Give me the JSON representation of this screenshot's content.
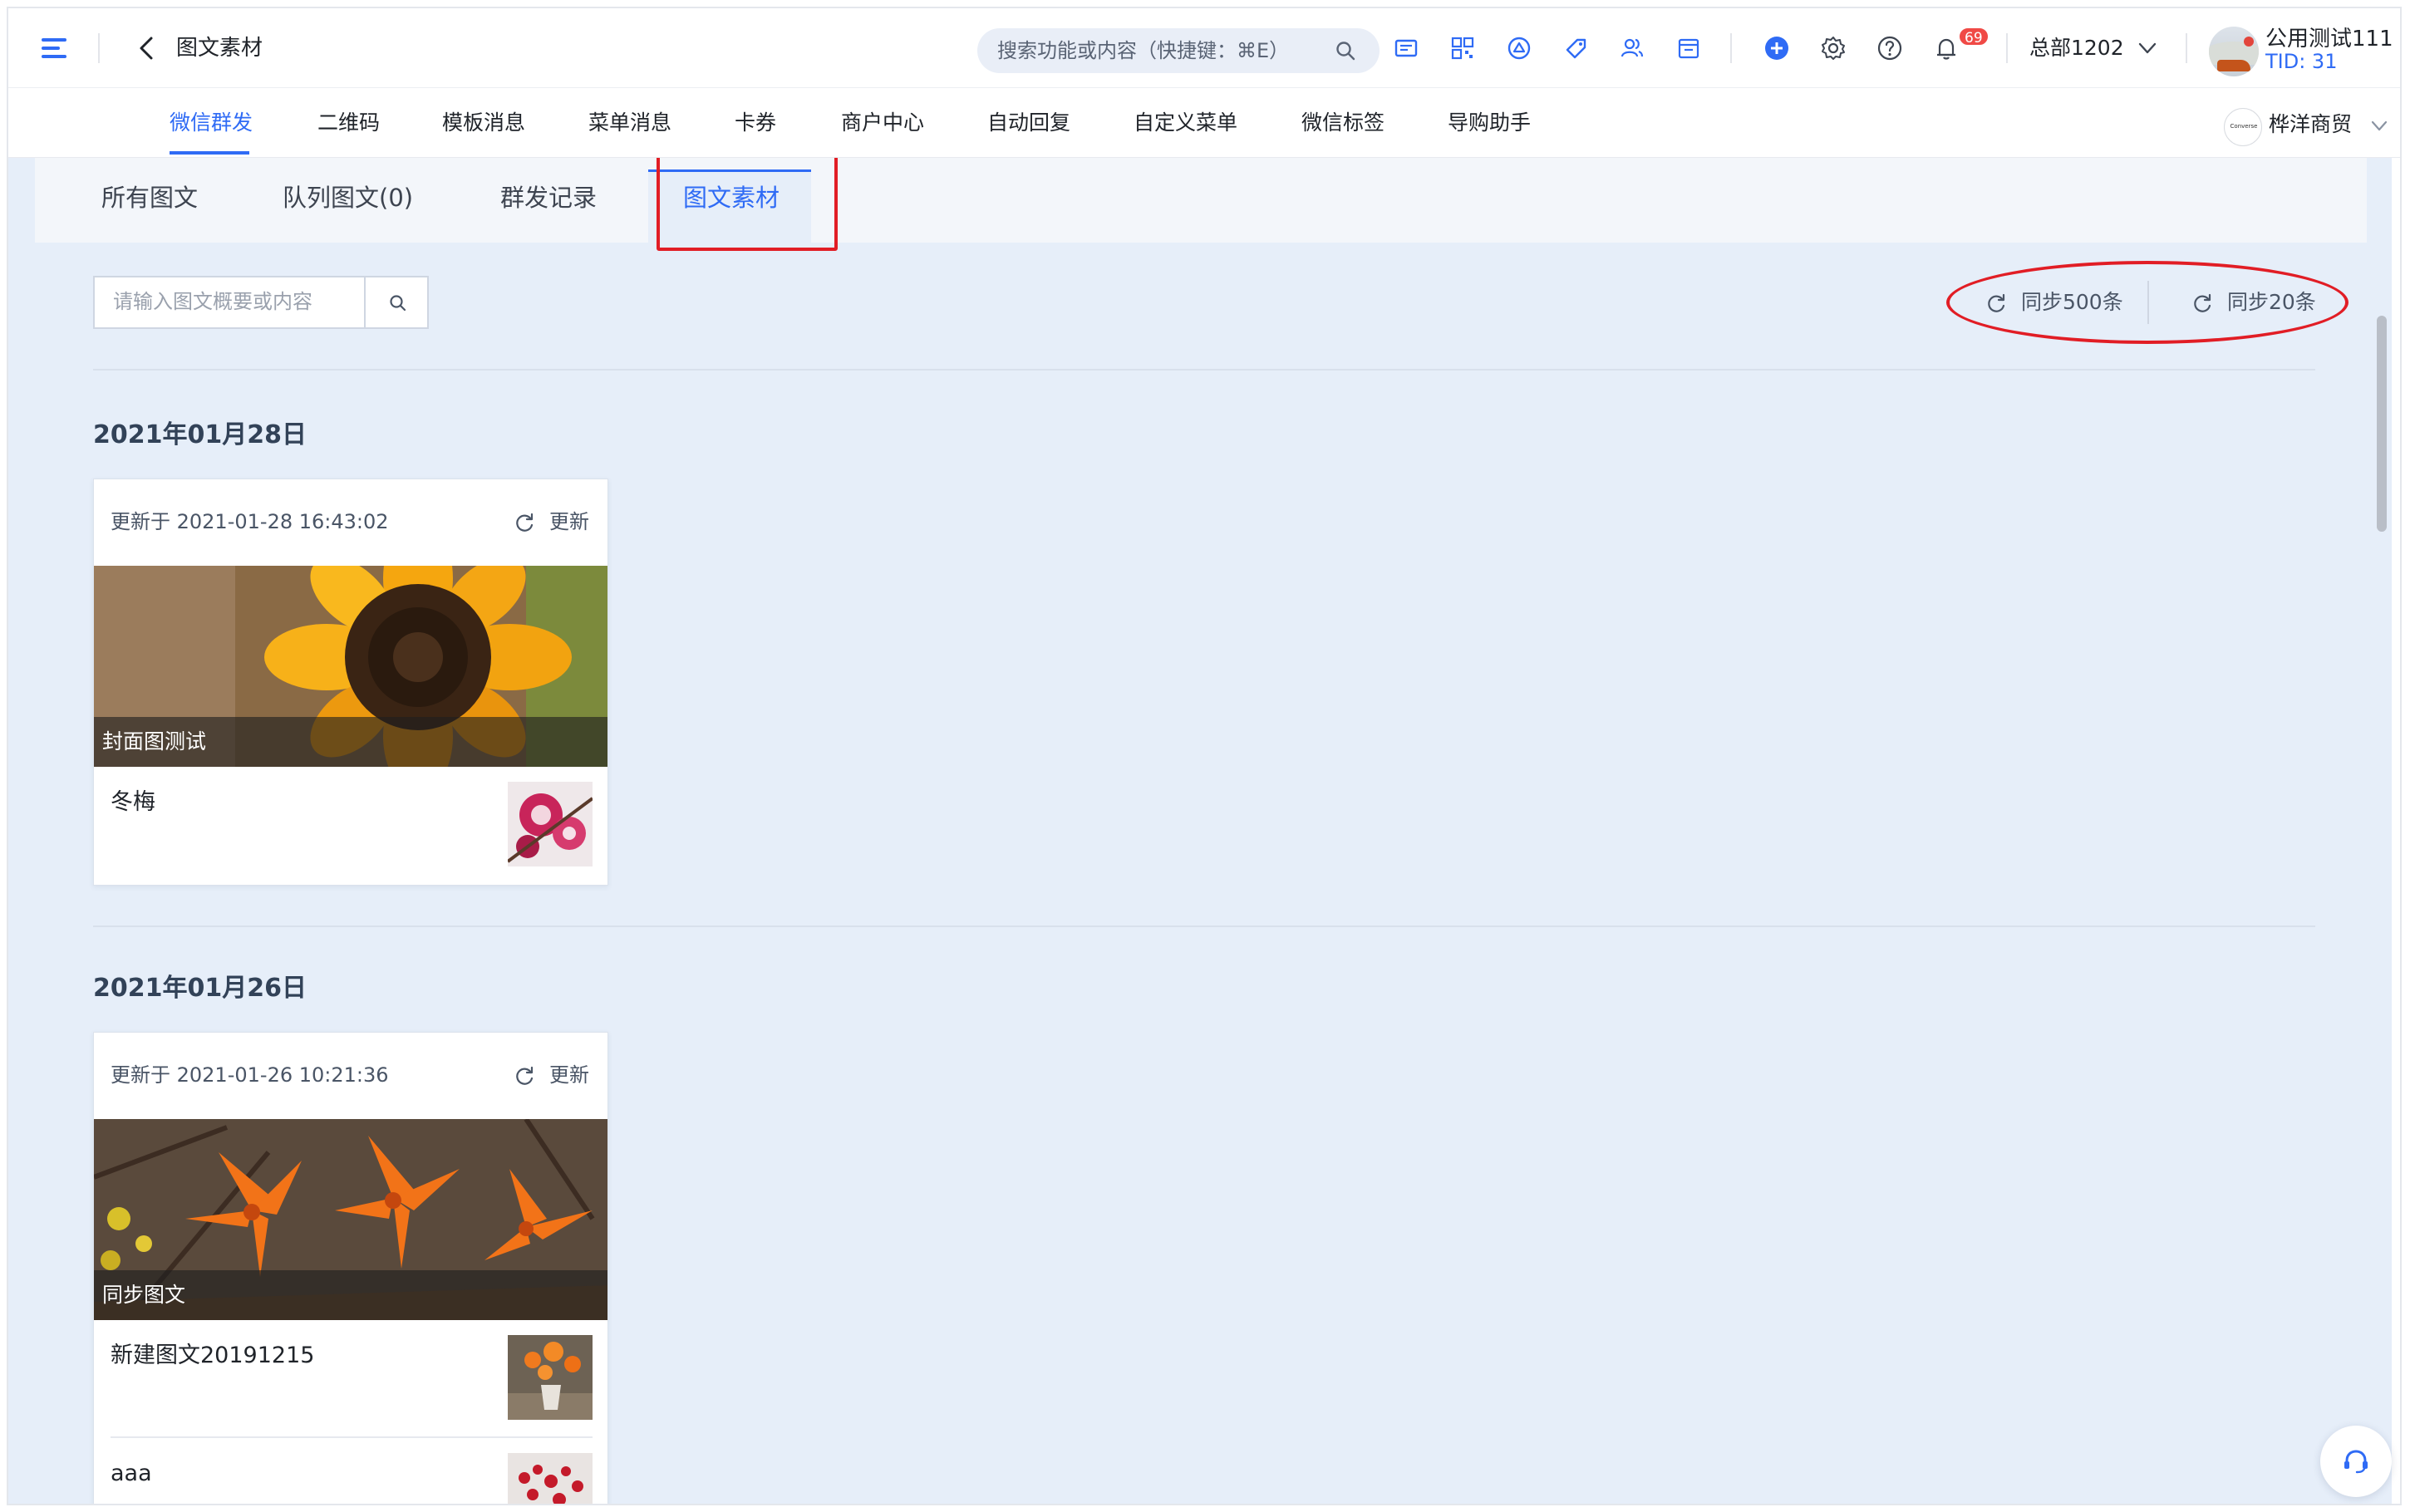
{
  "header": {
    "back_title": "图文素材",
    "search_placeholder": "搜索功能或内容（快捷键：⌘E）",
    "notification_count": "69",
    "org_name": "总部1202",
    "user_name": "公用测试111",
    "tid": "TID: 31",
    "tool_icons": [
      "message-icon",
      "qrcode-icon",
      "wechat-icon",
      "tag-icon",
      "users-icon",
      "calendar-icon",
      "add-icon",
      "settings-icon",
      "help-icon",
      "bell-icon"
    ]
  },
  "subnav": {
    "items": [
      "微信群发",
      "二维码",
      "模板消息",
      "菜单消息",
      "卡券",
      "商户中心",
      "自动回复",
      "自定义菜单",
      "微信标签",
      "导购助手"
    ],
    "active_index": 0,
    "shop_logo_text": "Converse",
    "shop_name": "桦洋商贸"
  },
  "tabs": {
    "items": [
      "所有图文",
      "队列图文(0)",
      "群发记录",
      "图文素材"
    ],
    "active_index": 3
  },
  "toolbar": {
    "search_placeholder": "请输入图文概要或内容",
    "sync_500": "同步500条",
    "sync_20": "同步20条"
  },
  "groups": [
    {
      "date": "2021年01月28日",
      "card": {
        "updated": "更新于 2021-01-28 16:43:02",
        "update_label": "更新",
        "cover_title": "封面图测试",
        "items": [
          "冬梅"
        ]
      }
    },
    {
      "date": "2021年01月26日",
      "card": {
        "updated": "更新于 2021-01-26 10:21:36",
        "update_label": "更新",
        "cover_title": "同步图文",
        "items": [
          "新建图文20191215",
          "aaa"
        ]
      }
    }
  ],
  "colors": {
    "accent": "#2f6bf5",
    "annotation_red": "#e11d25",
    "content_bg": "#e6eef9",
    "badge": "#f04a46"
  }
}
